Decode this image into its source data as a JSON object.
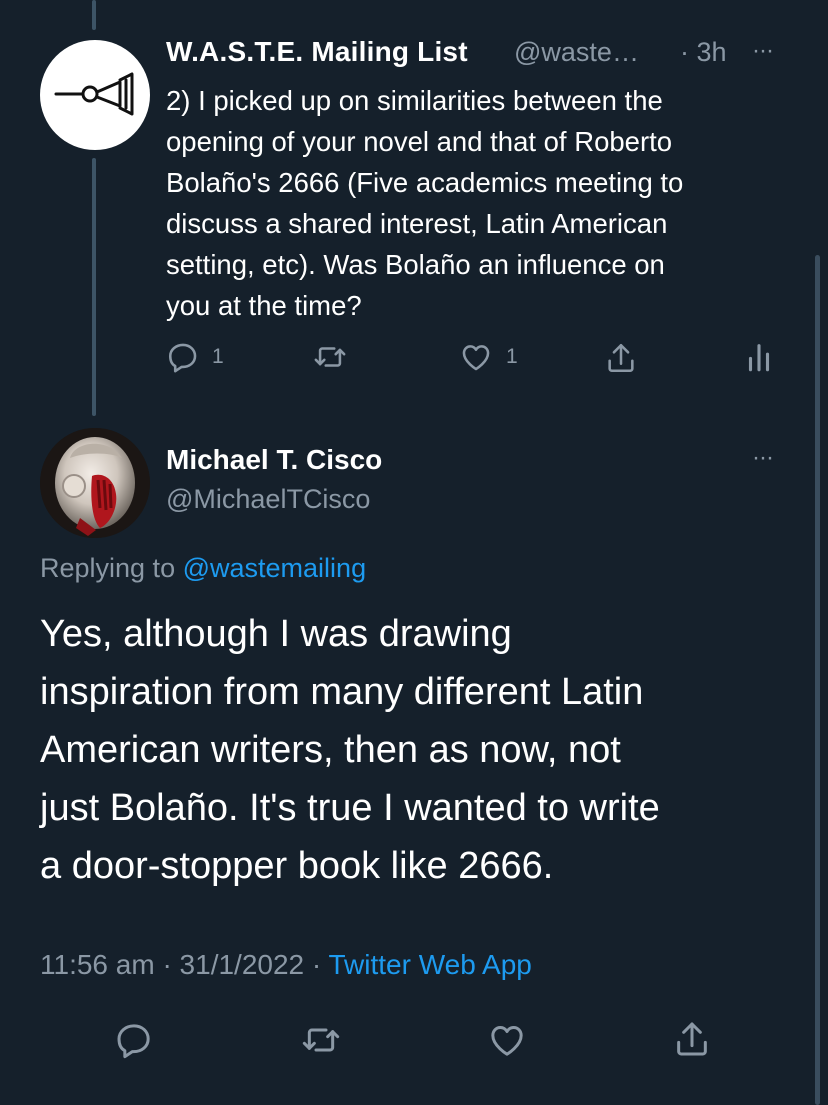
{
  "first_tweet": {
    "display_name": "W.A.S.T.E. Mailing List",
    "handle": "@waste…",
    "time": "· 3h",
    "more": "···",
    "text_lines": [
      "2) I picked up on similarities between the",
      "opening of your novel and that of Roberto",
      "Bolaño's 2666 (Five academics meeting to",
      "discuss a shared interest, Latin American",
      "setting, etc). Was Bolaño an influence on",
      "you at the time?"
    ],
    "reply_count": "1",
    "like_count": "1"
  },
  "main_tweet": {
    "display_name": "Michael T. Cisco",
    "handle": "@MichaelTCisco",
    "more": "···",
    "replying_prefix": "Replying to",
    "replying_handle": "@wastemailing",
    "text_lines": [
      "Yes, although I was drawing",
      "inspiration from many different Latin",
      "American writers, then as now, not",
      "just Bolaño.  It's true I wanted to write",
      "a door-stopper book like 2666."
    ],
    "timestamp": "11:56 am · 31/1/2022 ·",
    "source": "Twitter Web App"
  },
  "colors": {
    "background": "#15202b",
    "text": "#ffffff",
    "muted": "#8b98a5",
    "link": "#1d9bf0"
  }
}
